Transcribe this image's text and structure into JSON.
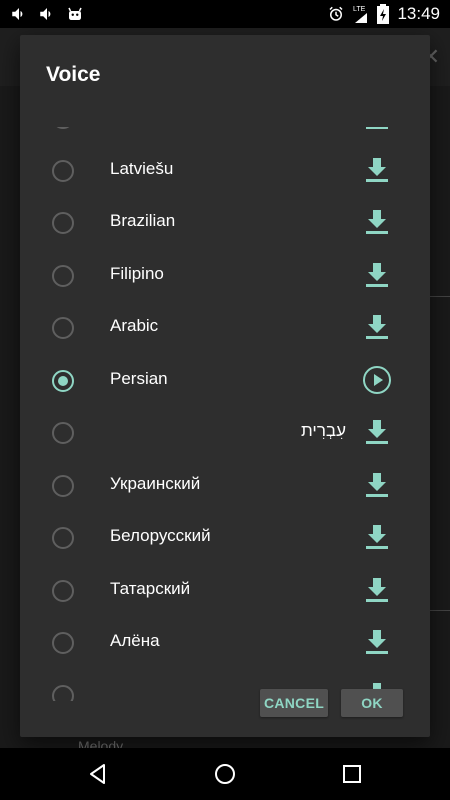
{
  "status_bar": {
    "time": "13:49",
    "left_icons": [
      "volume-icon",
      "volume-icon",
      "android-notification-icon"
    ],
    "right_icons": [
      "alarm-icon",
      "lte-signal-icon",
      "battery-charging-icon"
    ],
    "lte_label": "LTE"
  },
  "background": {
    "partial_text": "Melody"
  },
  "dialog": {
    "title": "Voice",
    "items": [
      {
        "label": "",
        "selected": false,
        "action": "download-icon"
      },
      {
        "label": "Latviešu",
        "selected": false,
        "action": "download-icon"
      },
      {
        "label": "Brazilian",
        "selected": false,
        "action": "download-icon"
      },
      {
        "label": "Filipino",
        "selected": false,
        "action": "download-icon"
      },
      {
        "label": "Arabic",
        "selected": false,
        "action": "download-icon"
      },
      {
        "label": "Persian",
        "selected": true,
        "action": "play-icon"
      },
      {
        "label": "עִבְרִית",
        "selected": false,
        "action": "download-icon"
      },
      {
        "label": "Украинский",
        "selected": false,
        "action": "download-icon"
      },
      {
        "label": "Белорусский",
        "selected": false,
        "action": "download-icon"
      },
      {
        "label": "Татарский",
        "selected": false,
        "action": "download-icon"
      },
      {
        "label": "Алёна",
        "selected": false,
        "action": "download-icon"
      },
      {
        "label": "",
        "selected": false,
        "action": "download-icon"
      }
    ],
    "cancel_label": "CANCEL",
    "ok_label": "OK"
  },
  "colors": {
    "accent": "#8fd6c4",
    "dialog_bg": "#2e2e2e",
    "button_bg": "#505050"
  }
}
